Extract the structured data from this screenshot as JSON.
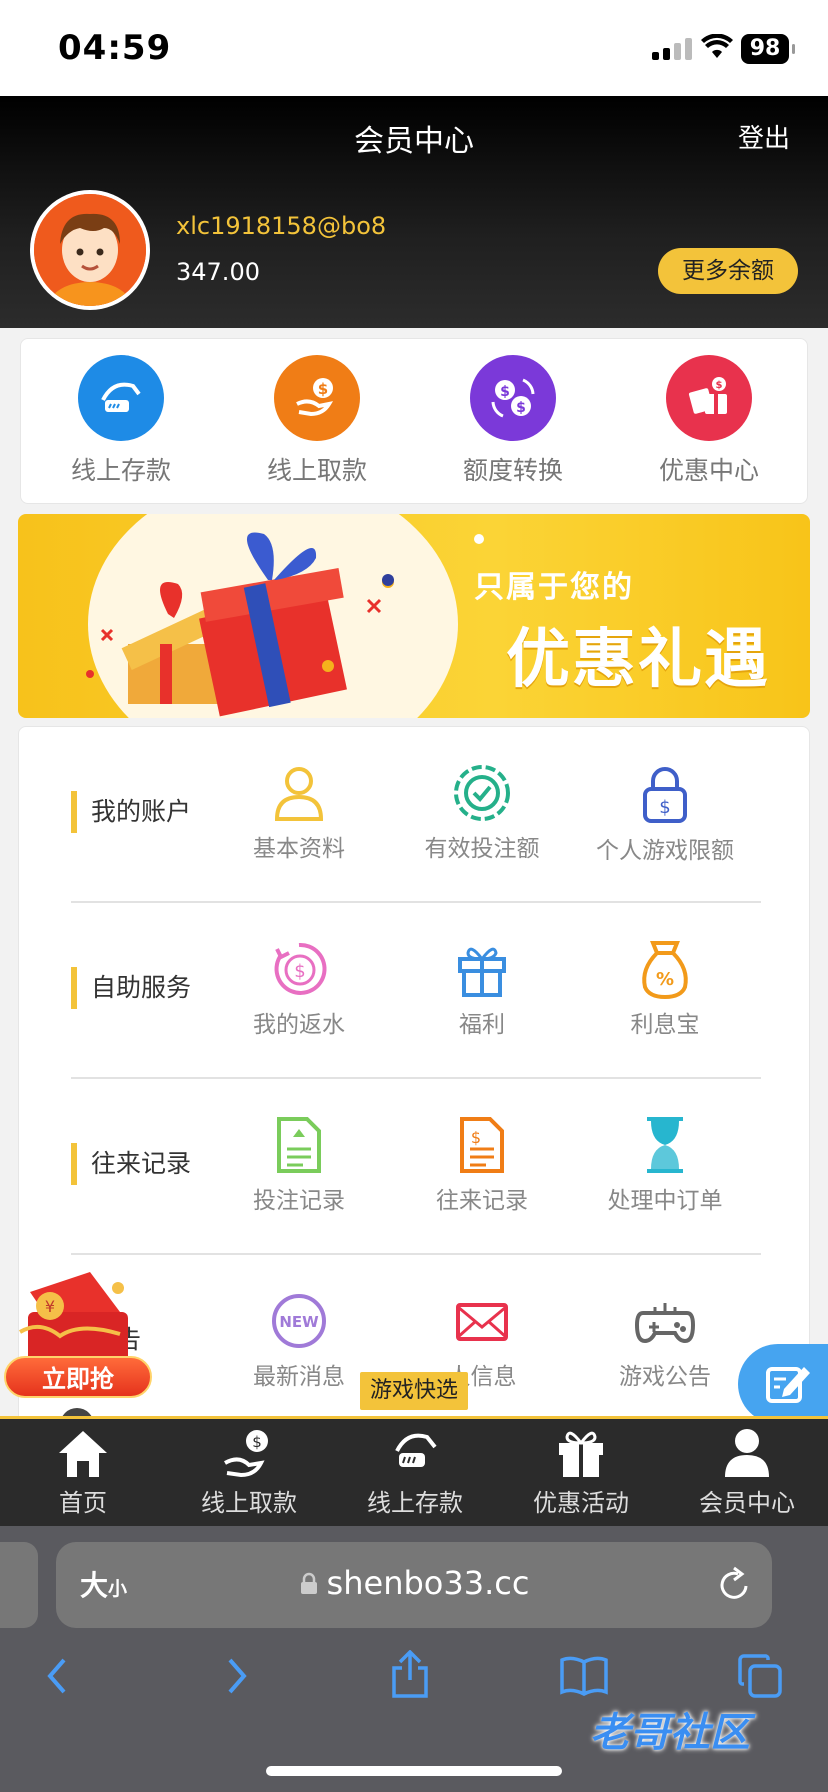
{
  "status_bar": {
    "time": "04:59",
    "battery": "98"
  },
  "header": {
    "title": "会员中心",
    "logout": "登出",
    "username": "xlc1918158@bo8",
    "balance": "347.00",
    "more_balance": "更多余额"
  },
  "quick_actions": [
    {
      "label": "线上存款",
      "icon": "deposit-icon",
      "color": "#1e8be6"
    },
    {
      "label": "线上取款",
      "icon": "withdraw-icon",
      "color": "#f07d16"
    },
    {
      "label": "额度转换",
      "icon": "transfer-icon",
      "color": "#7b39d9"
    },
    {
      "label": "优惠中心",
      "icon": "gift-card-icon",
      "color": "#e8324d"
    }
  ],
  "banner": {
    "line1": "只属于您的",
    "line2": "优惠礼遇"
  },
  "sections": [
    {
      "title": "我的账户",
      "items": [
        {
          "label": "基本资料",
          "icon": "user-icon"
        },
        {
          "label": "有效投注额",
          "icon": "chip-check-icon"
        },
        {
          "label": "个人游戏限额",
          "icon": "lock-dollar-icon"
        }
      ]
    },
    {
      "title": "自助服务",
      "items": [
        {
          "label": "我的返水",
          "icon": "rebate-icon"
        },
        {
          "label": "福利",
          "icon": "gift-icon"
        },
        {
          "label": "利息宝",
          "icon": "money-bag-icon"
        }
      ]
    },
    {
      "title": "往来记录",
      "items": [
        {
          "label": "投注记录",
          "icon": "bet-record-icon"
        },
        {
          "label": "往来记录",
          "icon": "transaction-record-icon"
        },
        {
          "label": "处理中订单",
          "icon": "hourglass-icon"
        }
      ]
    },
    {
      "title": "公告",
      "items": [
        {
          "label": "最新消息",
          "icon": "new-icon"
        },
        {
          "label": "人信息",
          "icon": "mail-icon"
        },
        {
          "label": "游戏公告",
          "icon": "gamepad-icon"
        }
      ]
    }
  ],
  "floating": {
    "grab": "立即抢",
    "close": "✕",
    "quick_game": "游戏快选"
  },
  "bottom_nav": [
    {
      "label": "首页",
      "icon": "home-icon"
    },
    {
      "label": "线上取款",
      "icon": "withdraw-icon"
    },
    {
      "label": "线上存款",
      "icon": "deposit-icon"
    },
    {
      "label": "优惠活动",
      "icon": "gift-icon"
    },
    {
      "label": "会员中心",
      "icon": "user-icon"
    }
  ],
  "browser": {
    "text_size_big": "大",
    "text_size_small": "小",
    "url": "shenbo33.cc"
  },
  "watermark": "老哥社区"
}
